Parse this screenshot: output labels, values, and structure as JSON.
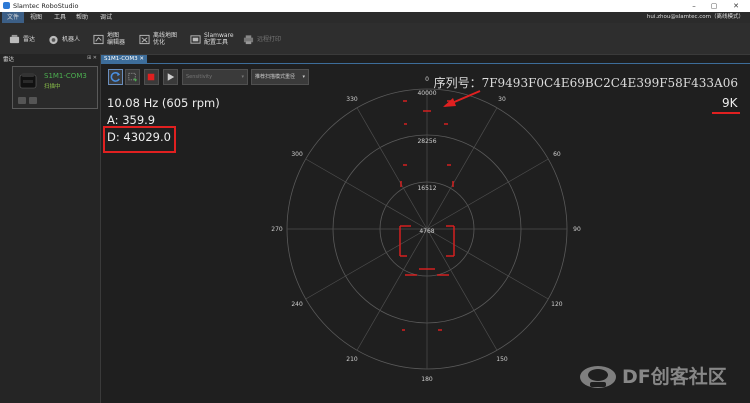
{
  "window": {
    "title": "Slamtec RoboStudio",
    "minimize": "–",
    "maximize": "▢",
    "close": "✕"
  },
  "menu": {
    "items": [
      "文件",
      "视图",
      "工具",
      "帮助",
      "调试"
    ],
    "user": "hui.zhou@slamtec.com（离线模式）"
  },
  "toolbar": {
    "items": [
      {
        "label": "雷达",
        "icon": "radar-icon"
      },
      {
        "label": "机器人",
        "icon": "robot-icon"
      },
      {
        "label": "地图\n编辑器",
        "icon": "map-editor-icon"
      },
      {
        "label": "离线地图\n优化",
        "icon": "offline-map-icon"
      },
      {
        "label": "Slamware\n配置工具",
        "icon": "slamware-config-icon"
      },
      {
        "label": "远程打印",
        "icon": "printer-icon"
      }
    ]
  },
  "left_panel": {
    "title": "雷达",
    "controls": "⊞ ✕",
    "device": {
      "name": "S1M1-COM3",
      "status": "扫描中"
    }
  },
  "doc_tab": {
    "label": "S1M1-COM3 ✕"
  },
  "scan_controls": {
    "mode_dropdown": "Sensitivity",
    "mode_dropdown_caret": "▾",
    "scan_dropdown": "推荐扫描模式重径",
    "scan_dropdown_caret": "▾"
  },
  "serial": "序列号：7F9493F0C4E69BC2C4E399F58F433A06",
  "readout": {
    "frequency": "10.08 Hz (605 rpm)",
    "angle": "A: 359.9",
    "distance": "D: 43029.0"
  },
  "range_label": "9K",
  "polar": {
    "angle_labels": [
      "0",
      "30",
      "60",
      "90",
      "120",
      "150",
      "180",
      "210",
      "240",
      "270",
      "300",
      "330"
    ],
    "ring_labels": [
      "4768",
      "16512",
      "28256",
      "40000"
    ]
  },
  "watermark": {
    "text": "DF创客社区"
  },
  "colors": {
    "accent": "#3d6d9a",
    "highlight": "#e02020",
    "online": "#4caf50"
  }
}
